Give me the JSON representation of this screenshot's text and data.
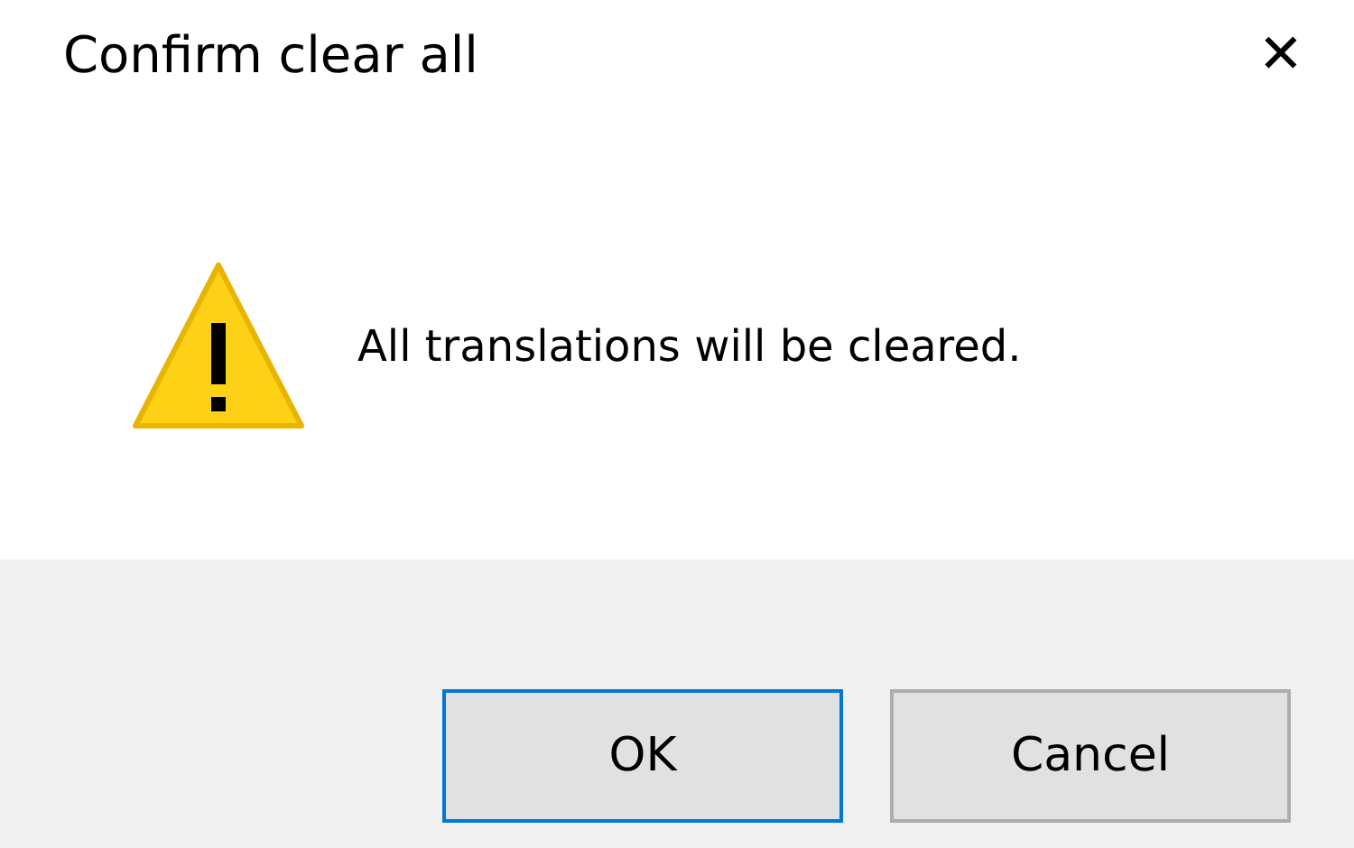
{
  "window": {
    "title": "Confirm clear all",
    "close": "✕"
  },
  "message": {
    "kind": "warning",
    "text": "All translations will be cleared."
  },
  "buttons": [
    {
      "label": "OK",
      "default": true
    },
    {
      "label": "Cancel",
      "default": false
    }
  ]
}
